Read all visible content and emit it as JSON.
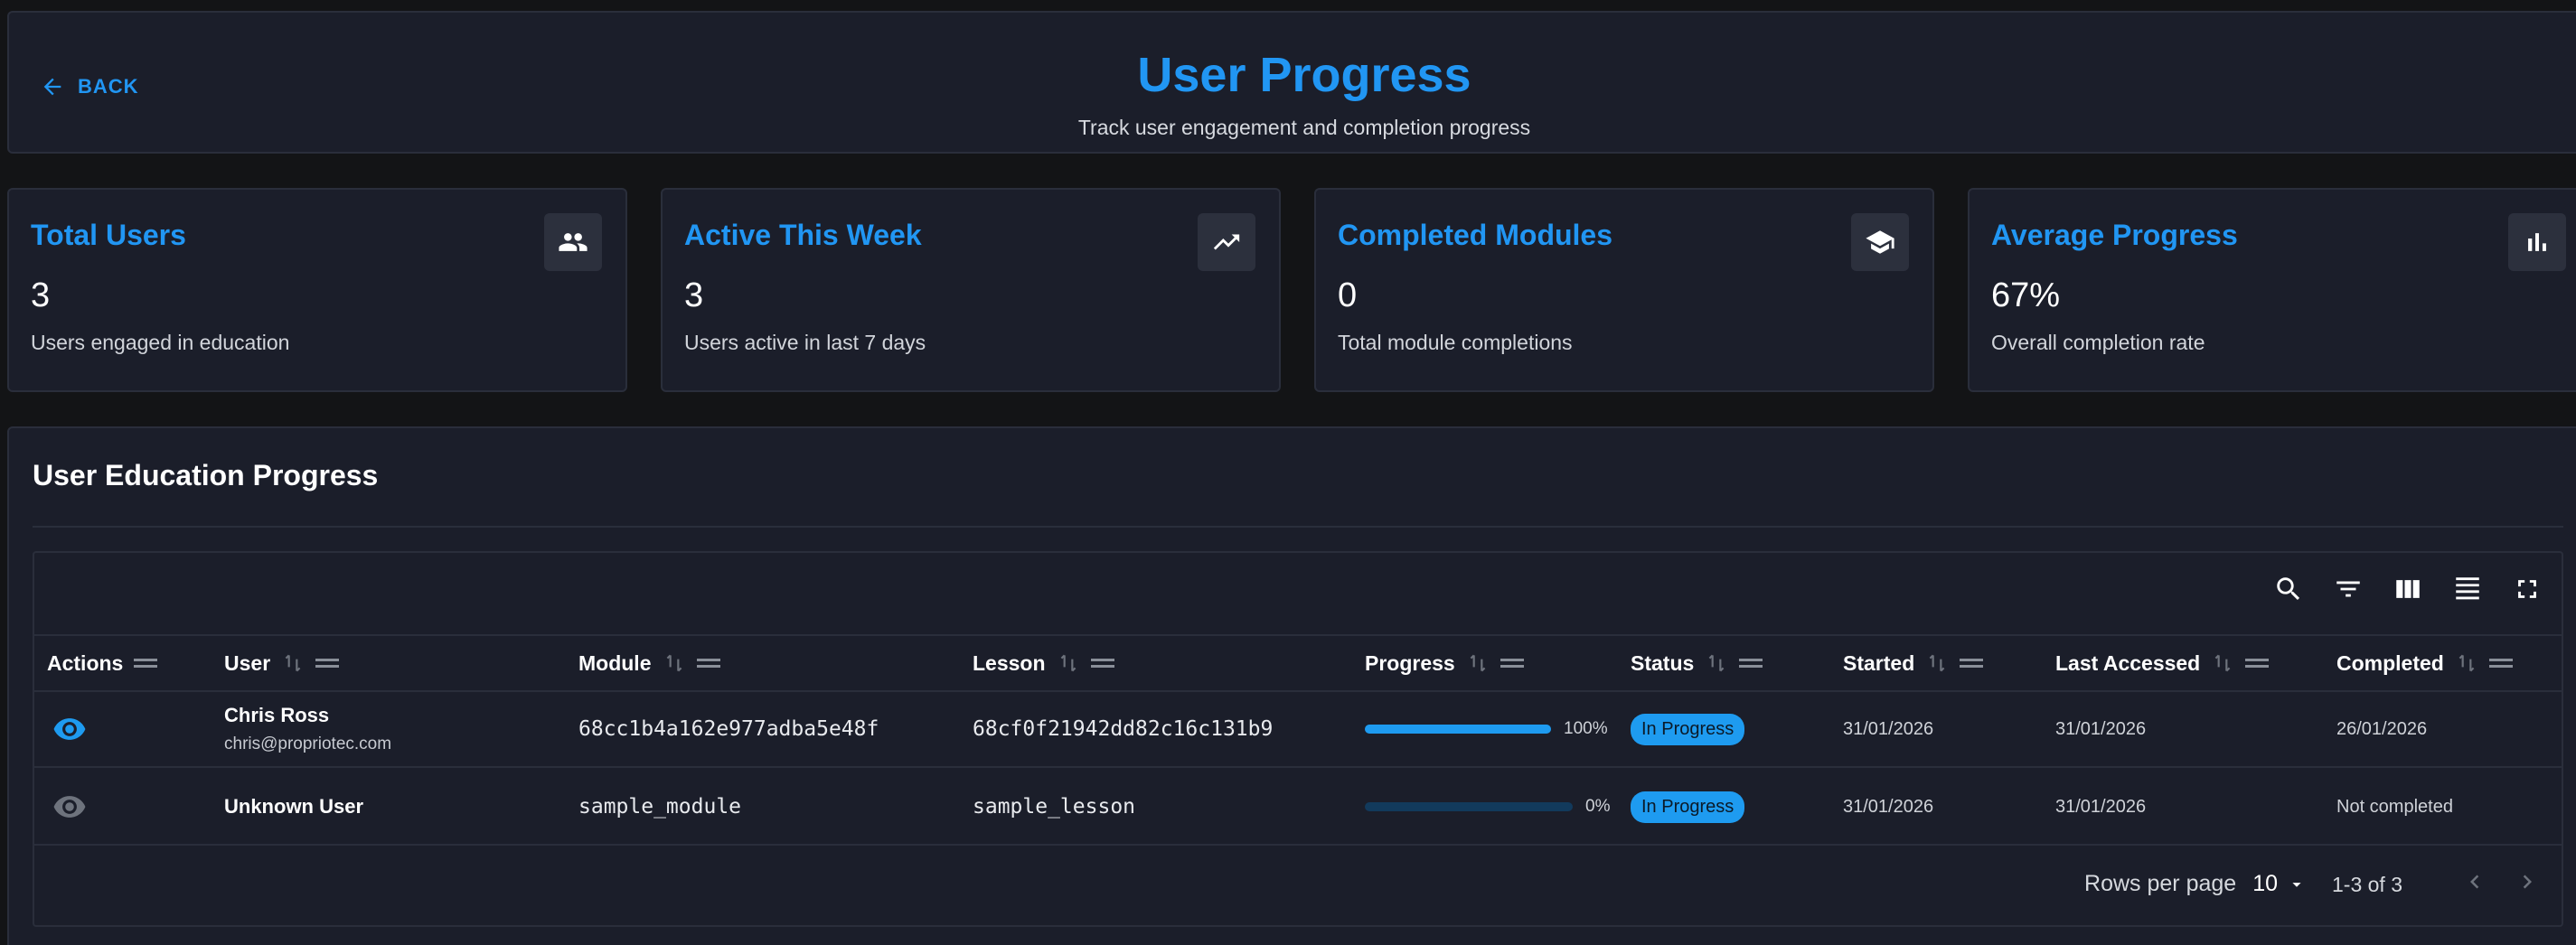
{
  "header": {
    "back_label": "BACK",
    "title": "User Progress",
    "subtitle": "Track user engagement and completion progress"
  },
  "stats": [
    {
      "title": "Total Users",
      "value": "3",
      "description": "Users engaged in education",
      "icon": "people-icon"
    },
    {
      "title": "Active This Week",
      "value": "3",
      "description": "Users active in last 7 days",
      "icon": "trending-up-icon"
    },
    {
      "title": "Completed Modules",
      "value": "0",
      "description": "Total module completions",
      "icon": "graduation-cap-icon"
    },
    {
      "title": "Average Progress",
      "value": "67%",
      "description": "Overall completion rate",
      "icon": "bar-chart-icon"
    }
  ],
  "section": {
    "title": "User Education Progress"
  },
  "table": {
    "columns": [
      "Actions",
      "User",
      "Module",
      "Lesson",
      "Progress",
      "Status",
      "Started",
      "Last Accessed",
      "Completed"
    ],
    "rows": [
      {
        "user_name": "Chris Ross",
        "user_email": "chris@propriotec.com",
        "module": "68cc1b4a162e977adba5e48f",
        "lesson": "68cf0f21942dd82c16c131b9",
        "progress": 1.0,
        "progress_label": "100%",
        "status": "In Progress",
        "started": "31/01/2026",
        "last_accessed": "31/01/2026",
        "completed": "26/01/2026"
      },
      {
        "user_name": "Unknown User",
        "user_email": "",
        "module": "sample_module",
        "lesson": "sample_lesson",
        "progress": 0.0,
        "progress_label": "0%",
        "status": "In Progress",
        "started": "31/01/2026",
        "last_accessed": "31/01/2026",
        "completed": "Not completed"
      }
    ]
  },
  "pagination": {
    "rows_per_page_label": "Rows per page",
    "rows_per_page_value": "10",
    "range_label": "1-3 of 3"
  },
  "colors": {
    "accent": "#2196f3",
    "badge": "#1e9bf0",
    "background": "#131416",
    "panel": "#1b1e2a"
  }
}
